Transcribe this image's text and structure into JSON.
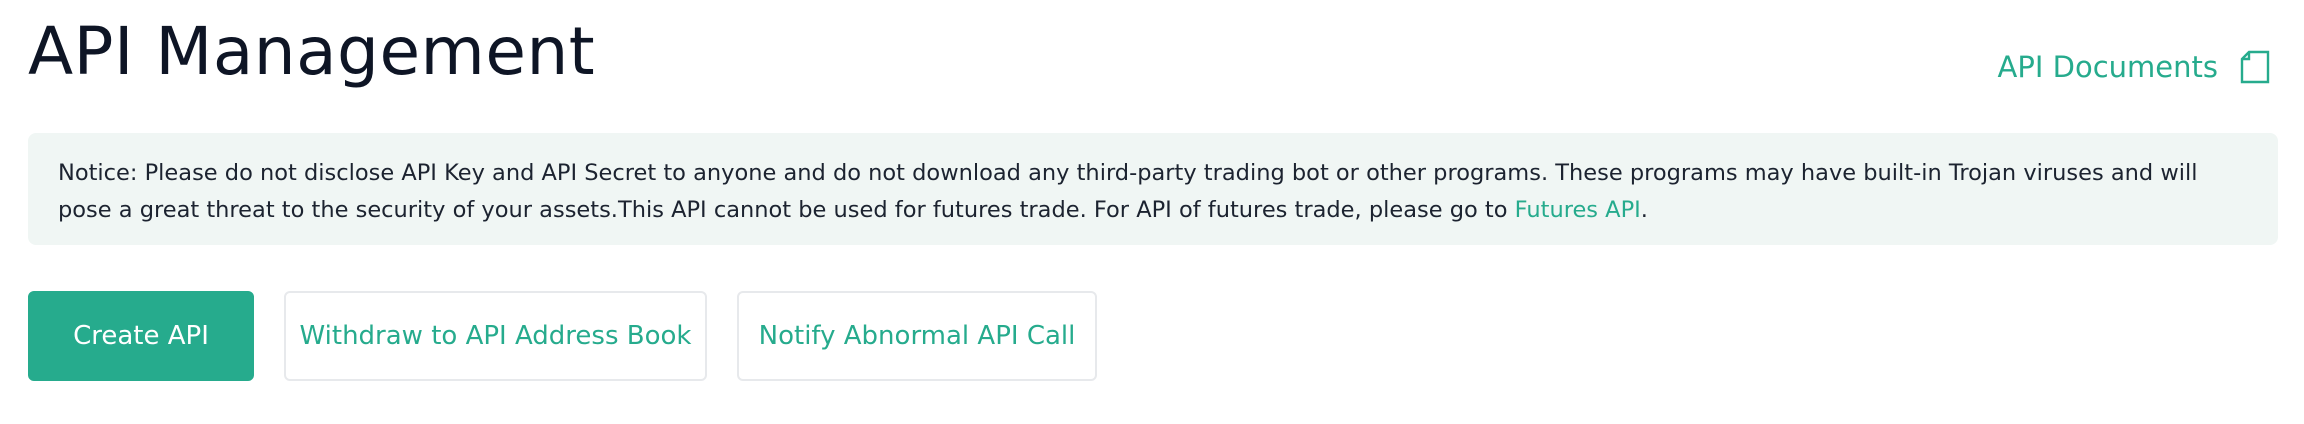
{
  "header": {
    "title": "API Management",
    "docs_link_label": "API Documents",
    "docs_icon": "document-icon"
  },
  "notice": {
    "text": "Notice: Please do not disclose API Key and API Secret to anyone and do not download any third-party trading bot or other programs. These programs may have built-in Trojan viruses and will pose a great threat to the security of your assets.This API cannot be used for futures trade. For API of futures trade, please go to ",
    "link_label": "Futures API",
    "suffix": "."
  },
  "actions": {
    "create_label": "Create API",
    "address_book_label": "Withdraw to API Address Book",
    "notify_label": "Notify Abnormal API Call"
  },
  "colors": {
    "accent": "#26ab8d",
    "title": "#0e1525",
    "notice_background": "#f0f6f4"
  }
}
